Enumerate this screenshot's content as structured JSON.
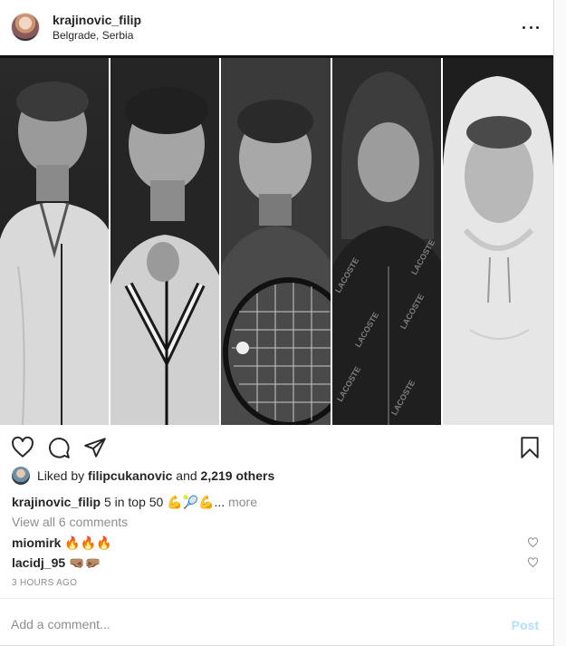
{
  "header": {
    "username": "krajinovic_filip",
    "location": "Belgrade, Serbia",
    "more_icon": "more-horizontal-icon"
  },
  "photo": {
    "panels": [
      "player-1",
      "player-2",
      "player-3",
      "player-4",
      "player-5"
    ],
    "brand_text": "LACOSTE"
  },
  "actions": {
    "like_icon": "heart-icon",
    "comment_icon": "comment-icon",
    "share_icon": "paper-plane-icon",
    "save_icon": "bookmark-icon"
  },
  "likes": {
    "prefix": "Liked by",
    "user": "filipcukanovic",
    "middle": "and",
    "others": "2,219 others"
  },
  "caption": {
    "username": "krajinovic_filip",
    "text": "5 in top 50",
    "emojis": "💪🎾💪",
    "ellipsis": "...",
    "more": "more"
  },
  "view_all": "View all 6 comments",
  "comments": [
    {
      "user": "miomirk",
      "text": "🔥🔥🔥"
    },
    {
      "user": "lacidj_95",
      "text": "🤜🏽🤛🏽"
    }
  ],
  "timestamp": "3 HOURS AGO",
  "comment_box": {
    "placeholder": "Add a comment...",
    "post_label": "Post"
  },
  "colors": {
    "text": "#262626",
    "muted": "#8e8e8e",
    "post_disabled": "#b2dffc"
  }
}
